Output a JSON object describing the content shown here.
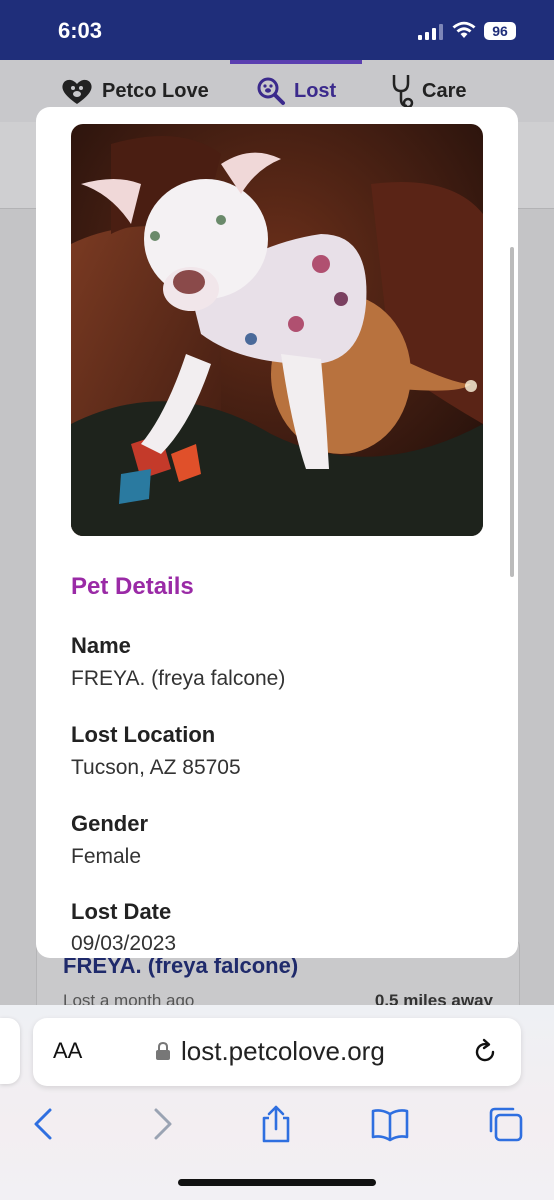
{
  "status_bar": {
    "time": "6:03",
    "battery": "96"
  },
  "nav": {
    "tabs": [
      {
        "label": "Petco Love",
        "icon": "heart-paw-icon"
      },
      {
        "label": "Lost",
        "icon": "search-paw-icon",
        "active": true
      },
      {
        "label": "Care",
        "icon": "stethoscope-icon"
      }
    ]
  },
  "background_card": {
    "pet_name": "FREYA. (freya falcone)",
    "time_ago": "Lost a month ago",
    "distance": "0.5 miles away"
  },
  "modal": {
    "photo": {
      "subject": "white and tan dog wearing shirt sitting on brown couch"
    },
    "section_title": "Pet Details",
    "fields": [
      {
        "label": "Name",
        "value": "FREYA. (freya falcone)"
      },
      {
        "label": "Lost Location",
        "value": "Tucson, AZ 85705"
      },
      {
        "label": "Gender",
        "value": "Female"
      },
      {
        "label": "Lost Date",
        "value": "09/03/2023"
      }
    ]
  },
  "safari": {
    "text_size_label": "AA",
    "url": "lost.petcolove.org"
  },
  "colors": {
    "status_bar": "#1f2e7a",
    "section_title": "#9a2aa6",
    "active_tab": "#3b2a8c",
    "toolbar_icons": "#2f6fe0"
  }
}
